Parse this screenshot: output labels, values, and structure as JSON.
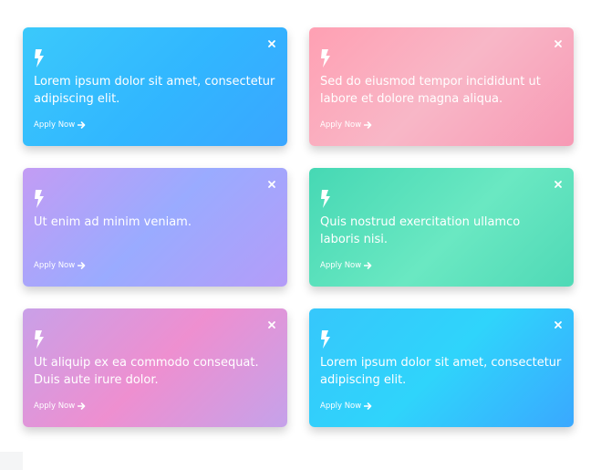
{
  "cards": [
    {
      "message": "Lorem ipsum dolor sit amet, consectetur adipiscing elit.",
      "cta": "Apply Now",
      "gradient": [
        "#38c8fb",
        "#3aa6ff"
      ]
    },
    {
      "message": "Sed do eiusmod tempor incididunt ut labore et dolore magna aliqua.",
      "cta": "Apply Now",
      "gradient": [
        "#ff9eb3",
        "#f7a0bf"
      ]
    },
    {
      "message": "Ut enim ad minim veniam.",
      "cta": "Apply Now",
      "gradient": [
        "#c29bf6",
        "#98a8ff"
      ]
    },
    {
      "message": "Quis nostrud exercitation ullamco laboris nisi.",
      "cta": "Apply Now",
      "gradient": [
        "#47d9b7",
        "#61e6bd"
      ]
    },
    {
      "message": "Ut aliquip ex ea commodo consequat. Duis aute irure dolor.",
      "cta": "Apply Now",
      "gradient": [
        "#c7a0ea",
        "#f08bce"
      ]
    },
    {
      "message": "Lorem ipsum dolor sit amet, consectetur adipiscing elit.",
      "cta": "Apply Now",
      "gradient": [
        "#35c6fb",
        "#3aa7ff"
      ]
    }
  ],
  "icons": {
    "card_icon": "lightning-bolt-icon",
    "close_icon": "close-icon",
    "cta_icon": "arrow-right-icon"
  }
}
